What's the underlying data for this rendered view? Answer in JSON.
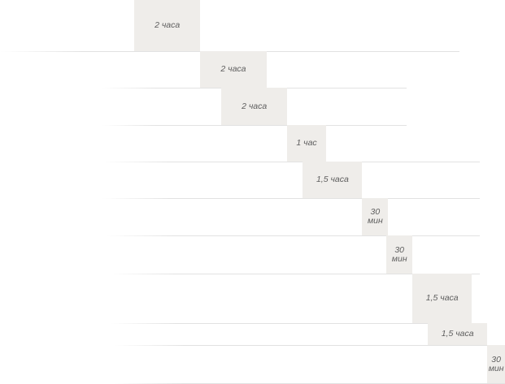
{
  "chart_data": {
    "type": "gantt",
    "unit": "minutes",
    "title": "",
    "xlabel": "",
    "ylabel": "",
    "grid": true,
    "legend": "none",
    "colors": {
      "bar": "#efedea",
      "label": "#5e5e5e",
      "rule": "#e2e2e2"
    },
    "tasks": [
      {
        "label": "2 часа",
        "start": 0,
        "duration": 120
      },
      {
        "label": "2 часа",
        "start": 120,
        "duration": 120
      },
      {
        "label": "2 часа",
        "start": 158,
        "duration": 120
      },
      {
        "label": "1 час",
        "start": 278,
        "duration": 70
      },
      {
        "label": "1,5 часа",
        "start": 306,
        "duration": 108
      },
      {
        "label": "30\nмин",
        "start": 414,
        "duration": 47
      },
      {
        "label": "30\nмин",
        "start": 458,
        "duration": 47
      },
      {
        "label": "1,5 часа",
        "start": 505,
        "duration": 108
      },
      {
        "label": "1,5 часа",
        "start": 533,
        "duration": 108
      },
      {
        "label": "30\nмин",
        "start": 641,
        "duration": 47
      }
    ]
  }
}
